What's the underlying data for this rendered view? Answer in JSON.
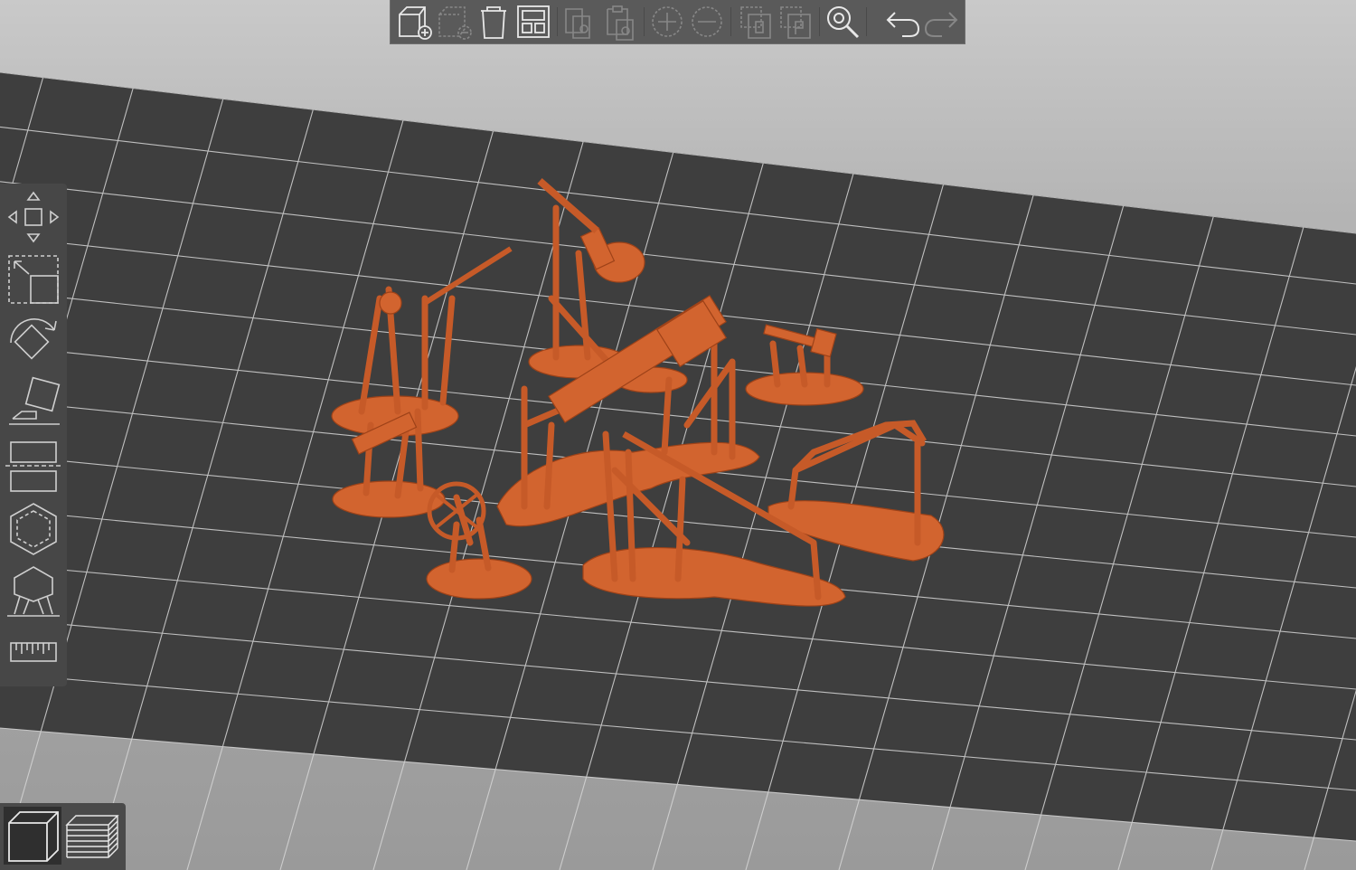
{
  "app": {
    "view": "3D model view",
    "accent_color": "#d2642f",
    "plate_color": "#3e3e3e",
    "grid_color": "#d8d8d8",
    "background_color": "#b8b8b8"
  },
  "top_toolbar": {
    "buttons": [
      {
        "icon": "add-model-icon",
        "enabled": true
      },
      {
        "icon": "remove-selection-icon",
        "enabled": false
      },
      {
        "icon": "delete-icon",
        "enabled": true
      },
      {
        "icon": "arrange-icon",
        "enabled": true
      },
      {
        "icon": "copy-icon",
        "enabled": false
      },
      {
        "icon": "paste-icon",
        "enabled": false
      },
      {
        "icon": "add-instance-icon",
        "enabled": false
      },
      {
        "icon": "remove-instance-icon",
        "enabled": false
      },
      {
        "icon": "split-objects-icon",
        "enabled": false
      },
      {
        "icon": "split-parts-icon",
        "enabled": false
      },
      {
        "icon": "search-icon",
        "enabled": true
      },
      {
        "icon": "undo-icon",
        "enabled": true
      },
      {
        "icon": "redo-icon",
        "enabled": false
      }
    ]
  },
  "left_toolbar": {
    "tools": [
      {
        "icon": "move-icon"
      },
      {
        "icon": "scale-icon"
      },
      {
        "icon": "rotate-icon"
      },
      {
        "icon": "place-on-face-icon"
      },
      {
        "icon": "cut-icon"
      },
      {
        "icon": "hollow-icon"
      },
      {
        "icon": "support-points-icon"
      },
      {
        "icon": "measure-icon"
      }
    ]
  },
  "view_mode": {
    "buttons": [
      {
        "icon": "3d-view-icon",
        "active": true
      },
      {
        "icon": "preview-layers-icon",
        "active": false
      }
    ]
  }
}
